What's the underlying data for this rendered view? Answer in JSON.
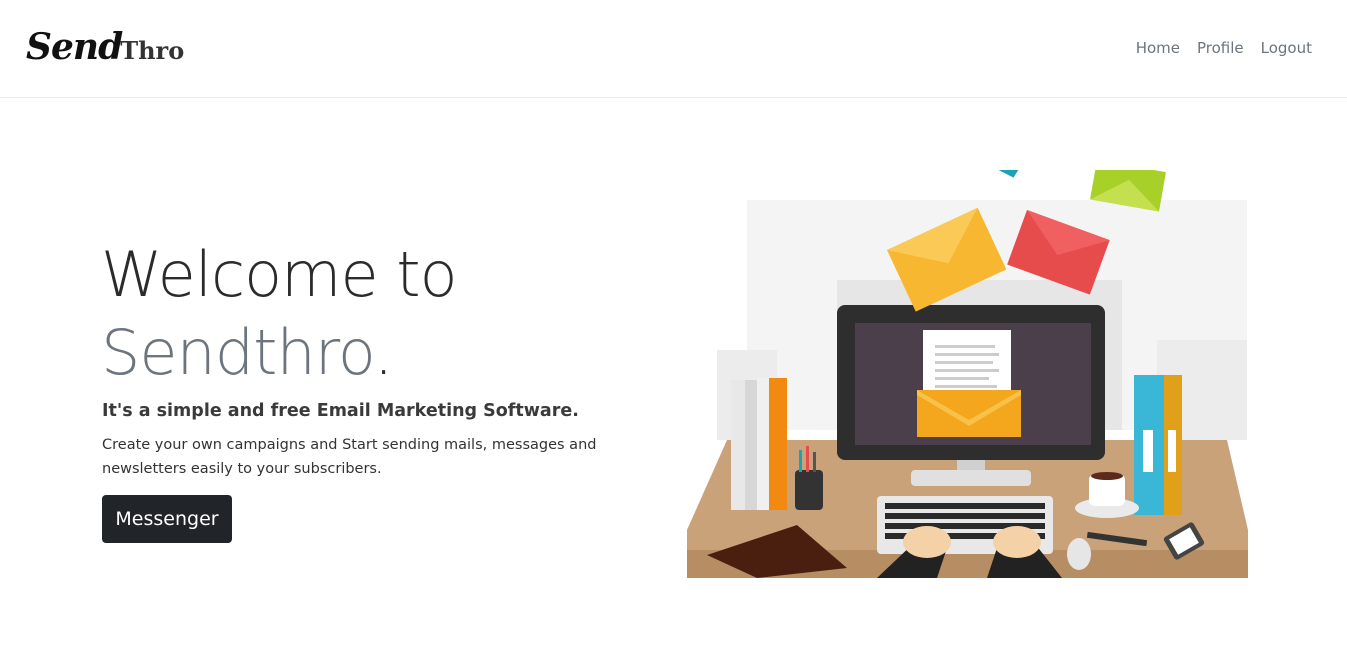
{
  "nav": {
    "brand_bold": "Send",
    "brand_rest": "Thro",
    "links": [
      "Home",
      "Profile",
      "Logout"
    ]
  },
  "hero": {
    "title_line1": "Welcome to",
    "title_line2": "Sendthro",
    "title_period": ".",
    "tagline": "It's a simple and free Email Marketing Software.",
    "description": "Create your own campaigns and Start sending mails, messages and newsletters easily to your subscribers.",
    "button_label": "Messenger"
  },
  "colors": {
    "button_bg": "#212529",
    "muted_text": "#6c757d",
    "envelope_yellow": "#f7b731",
    "envelope_red": "#e74c4c",
    "envelope_green": "#a7d129",
    "envelope_teal": "#1aa3b5",
    "desk": "#c9a27a"
  },
  "icons": {
    "illustration": "email-marketing-desk-illustration"
  }
}
